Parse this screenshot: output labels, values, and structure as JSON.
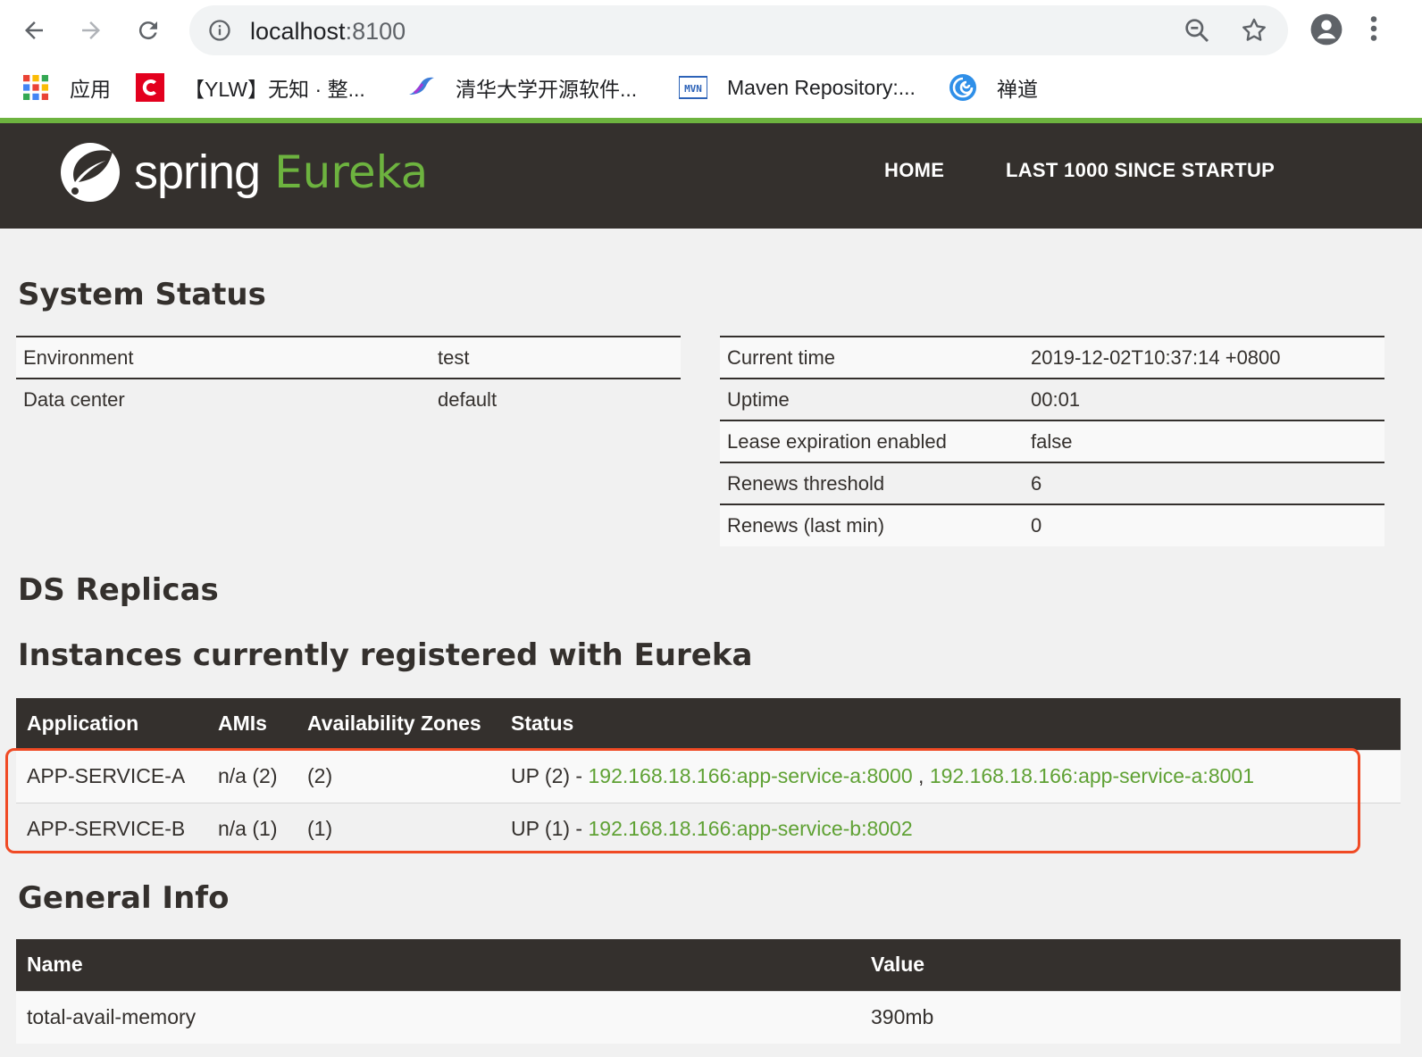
{
  "browser": {
    "url_host": "localhost",
    "url_port": ":8100",
    "bookmarks": [
      {
        "label": "应用",
        "icon": "apps-grid-icon"
      },
      {
        "label": "【YLW】无知 · 整...",
        "icon": "csdn-c-icon"
      },
      {
        "label": "清华大学开源软件...",
        "icon": "tsinghua-bird-icon"
      },
      {
        "label": "Maven Repository:...",
        "icon": "mvn-icon"
      },
      {
        "label": "禅道",
        "icon": "zentao-swirl-icon"
      }
    ]
  },
  "header": {
    "logo_spring": "spring",
    "logo_eureka": "Eureka",
    "nav": [
      "HOME",
      "LAST 1000 SINCE STARTUP"
    ]
  },
  "system_status": {
    "title": "System Status",
    "left": [
      {
        "key": "Environment",
        "value": "test"
      },
      {
        "key": "Data center",
        "value": "default"
      }
    ],
    "right": [
      {
        "key": "Current time",
        "value": "2019-12-02T10:37:14 +0800"
      },
      {
        "key": "Uptime",
        "value": "00:01"
      },
      {
        "key": "Lease expiration enabled",
        "value": "false"
      },
      {
        "key": "Renews threshold",
        "value": "6"
      },
      {
        "key": "Renews (last min)",
        "value": "0"
      }
    ]
  },
  "ds_replicas": {
    "title": "DS Replicas"
  },
  "instances": {
    "title": "Instances currently registered with Eureka",
    "headers": [
      "Application",
      "AMIs",
      "Availability Zones",
      "Status"
    ],
    "rows": [
      {
        "application": "APP-SERVICE-A",
        "amis": "n/a (2)",
        "zones": "(2)",
        "status_prefix": "UP (2) -",
        "links": [
          "192.168.18.166:app-service-a:8000",
          "192.168.18.166:app-service-a:8001"
        ],
        "separator": ","
      },
      {
        "application": "APP-SERVICE-B",
        "amis": "n/a (1)",
        "zones": "(1)",
        "status_prefix": "UP (1) -",
        "links": [
          "192.168.18.166:app-service-b:8002"
        ],
        "separator": ""
      }
    ]
  },
  "general_info": {
    "title": "General Info",
    "headers": [
      "Name",
      "Value"
    ],
    "rows": [
      {
        "name": "total-avail-memory",
        "value": "390mb"
      }
    ]
  },
  "colors": {
    "spring_green": "#6db33f",
    "header_dark": "#34302d",
    "highlight_red": "#f04a24"
  }
}
